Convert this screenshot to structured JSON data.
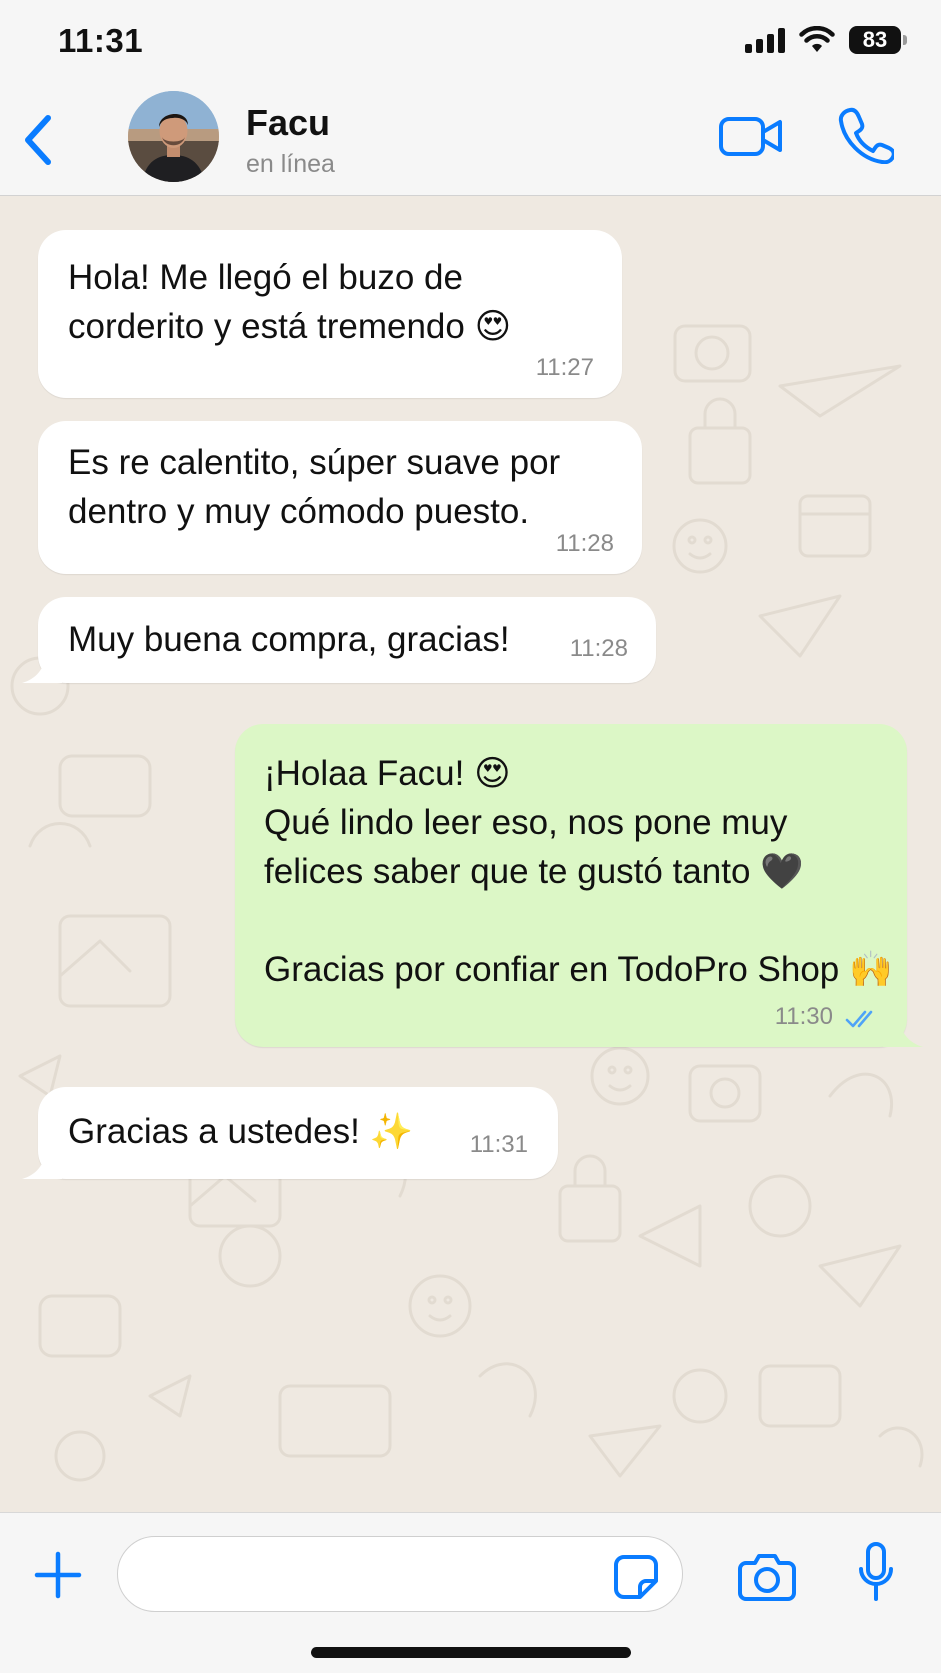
{
  "status_bar": {
    "time": "11:31",
    "battery": "83",
    "icons": [
      "signal-icon",
      "wifi-icon",
      "battery-icon"
    ]
  },
  "header": {
    "back_icon": "chevron-left-icon",
    "contact_name": "Facu",
    "contact_status": "en línea",
    "video_icon": "video-camera-icon",
    "call_icon": "phone-icon"
  },
  "messages": [
    {
      "direction": "in",
      "text": "Hola! Me llegó el buzo de\ncorderito y está tremendo 😍",
      "time": "11:27"
    },
    {
      "direction": "in",
      "text": "Es re calentito, súper suave por\ndentro y muy cómodo puesto.",
      "time": "11:28"
    },
    {
      "direction": "in",
      "text": "Muy buena compra, gracias!",
      "time": "11:28"
    },
    {
      "direction": "out",
      "text": "¡Holaa Facu! 😍\nQué lindo leer eso, nos pone muy\nfelices saber que te gustó tanto 🖤\n\nGracias por confiar en TodoPro Shop 🙌",
      "time": "11:30",
      "status": "read"
    },
    {
      "direction": "in",
      "text": "Gracias a ustedes! ✨",
      "time": "11:31"
    }
  ],
  "input_bar": {
    "plus_icon": "plus-icon",
    "placeholder": "",
    "sticker_icon": "sticker-icon",
    "camera_icon": "camera-icon",
    "mic_icon": "microphone-icon"
  },
  "colors": {
    "accent": "#0a7cff",
    "incoming_bubble": "#ffffff",
    "outgoing_bubble": "#dcf7c6",
    "chat_background": "#efe9e1",
    "read_ticks": "#4fa3f7"
  }
}
